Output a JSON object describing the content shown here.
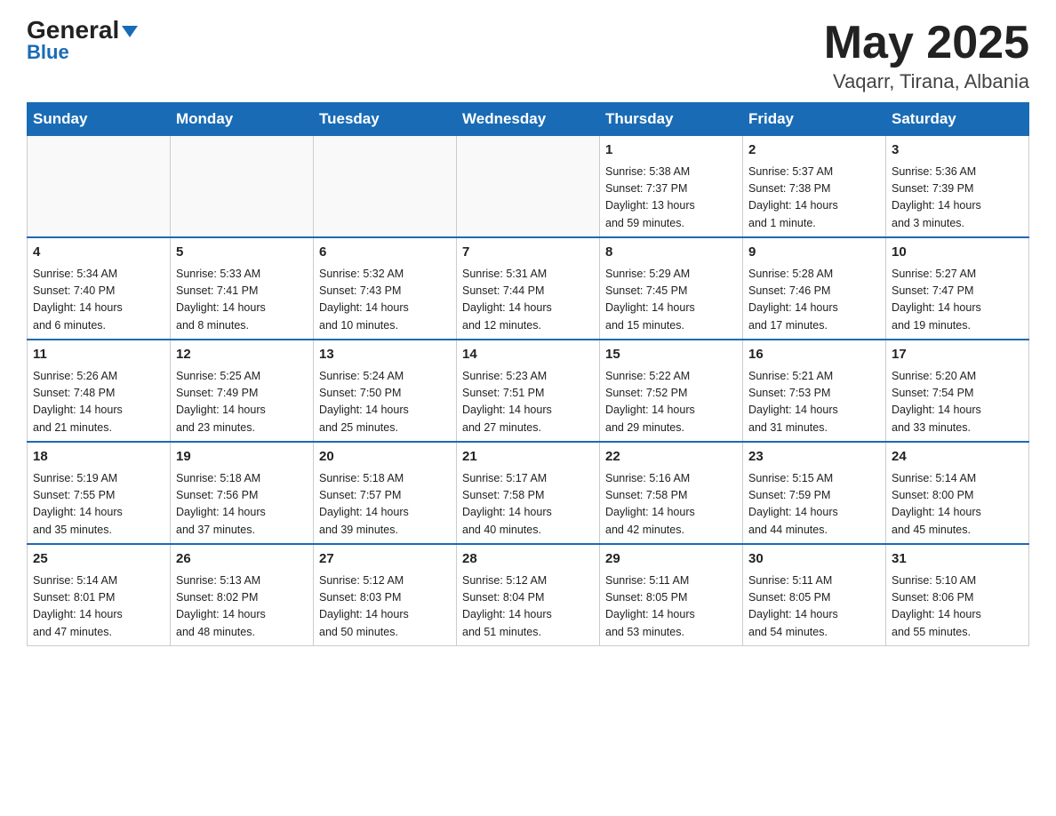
{
  "header": {
    "logo_general": "General",
    "logo_blue": "Blue",
    "month_title": "May 2025",
    "location": "Vaqarr, Tirana, Albania"
  },
  "weekdays": [
    "Sunday",
    "Monday",
    "Tuesday",
    "Wednesday",
    "Thursday",
    "Friday",
    "Saturday"
  ],
  "weeks": [
    [
      {
        "day": "",
        "info": ""
      },
      {
        "day": "",
        "info": ""
      },
      {
        "day": "",
        "info": ""
      },
      {
        "day": "",
        "info": ""
      },
      {
        "day": "1",
        "info": "Sunrise: 5:38 AM\nSunset: 7:37 PM\nDaylight: 13 hours\nand 59 minutes."
      },
      {
        "day": "2",
        "info": "Sunrise: 5:37 AM\nSunset: 7:38 PM\nDaylight: 14 hours\nand 1 minute."
      },
      {
        "day": "3",
        "info": "Sunrise: 5:36 AM\nSunset: 7:39 PM\nDaylight: 14 hours\nand 3 minutes."
      }
    ],
    [
      {
        "day": "4",
        "info": "Sunrise: 5:34 AM\nSunset: 7:40 PM\nDaylight: 14 hours\nand 6 minutes."
      },
      {
        "day": "5",
        "info": "Sunrise: 5:33 AM\nSunset: 7:41 PM\nDaylight: 14 hours\nand 8 minutes."
      },
      {
        "day": "6",
        "info": "Sunrise: 5:32 AM\nSunset: 7:43 PM\nDaylight: 14 hours\nand 10 minutes."
      },
      {
        "day": "7",
        "info": "Sunrise: 5:31 AM\nSunset: 7:44 PM\nDaylight: 14 hours\nand 12 minutes."
      },
      {
        "day": "8",
        "info": "Sunrise: 5:29 AM\nSunset: 7:45 PM\nDaylight: 14 hours\nand 15 minutes."
      },
      {
        "day": "9",
        "info": "Sunrise: 5:28 AM\nSunset: 7:46 PM\nDaylight: 14 hours\nand 17 minutes."
      },
      {
        "day": "10",
        "info": "Sunrise: 5:27 AM\nSunset: 7:47 PM\nDaylight: 14 hours\nand 19 minutes."
      }
    ],
    [
      {
        "day": "11",
        "info": "Sunrise: 5:26 AM\nSunset: 7:48 PM\nDaylight: 14 hours\nand 21 minutes."
      },
      {
        "day": "12",
        "info": "Sunrise: 5:25 AM\nSunset: 7:49 PM\nDaylight: 14 hours\nand 23 minutes."
      },
      {
        "day": "13",
        "info": "Sunrise: 5:24 AM\nSunset: 7:50 PM\nDaylight: 14 hours\nand 25 minutes."
      },
      {
        "day": "14",
        "info": "Sunrise: 5:23 AM\nSunset: 7:51 PM\nDaylight: 14 hours\nand 27 minutes."
      },
      {
        "day": "15",
        "info": "Sunrise: 5:22 AM\nSunset: 7:52 PM\nDaylight: 14 hours\nand 29 minutes."
      },
      {
        "day": "16",
        "info": "Sunrise: 5:21 AM\nSunset: 7:53 PM\nDaylight: 14 hours\nand 31 minutes."
      },
      {
        "day": "17",
        "info": "Sunrise: 5:20 AM\nSunset: 7:54 PM\nDaylight: 14 hours\nand 33 minutes."
      }
    ],
    [
      {
        "day": "18",
        "info": "Sunrise: 5:19 AM\nSunset: 7:55 PM\nDaylight: 14 hours\nand 35 minutes."
      },
      {
        "day": "19",
        "info": "Sunrise: 5:18 AM\nSunset: 7:56 PM\nDaylight: 14 hours\nand 37 minutes."
      },
      {
        "day": "20",
        "info": "Sunrise: 5:18 AM\nSunset: 7:57 PM\nDaylight: 14 hours\nand 39 minutes."
      },
      {
        "day": "21",
        "info": "Sunrise: 5:17 AM\nSunset: 7:58 PM\nDaylight: 14 hours\nand 40 minutes."
      },
      {
        "day": "22",
        "info": "Sunrise: 5:16 AM\nSunset: 7:58 PM\nDaylight: 14 hours\nand 42 minutes."
      },
      {
        "day": "23",
        "info": "Sunrise: 5:15 AM\nSunset: 7:59 PM\nDaylight: 14 hours\nand 44 minutes."
      },
      {
        "day": "24",
        "info": "Sunrise: 5:14 AM\nSunset: 8:00 PM\nDaylight: 14 hours\nand 45 minutes."
      }
    ],
    [
      {
        "day": "25",
        "info": "Sunrise: 5:14 AM\nSunset: 8:01 PM\nDaylight: 14 hours\nand 47 minutes."
      },
      {
        "day": "26",
        "info": "Sunrise: 5:13 AM\nSunset: 8:02 PM\nDaylight: 14 hours\nand 48 minutes."
      },
      {
        "day": "27",
        "info": "Sunrise: 5:12 AM\nSunset: 8:03 PM\nDaylight: 14 hours\nand 50 minutes."
      },
      {
        "day": "28",
        "info": "Sunrise: 5:12 AM\nSunset: 8:04 PM\nDaylight: 14 hours\nand 51 minutes."
      },
      {
        "day": "29",
        "info": "Sunrise: 5:11 AM\nSunset: 8:05 PM\nDaylight: 14 hours\nand 53 minutes."
      },
      {
        "day": "30",
        "info": "Sunrise: 5:11 AM\nSunset: 8:05 PM\nDaylight: 14 hours\nand 54 minutes."
      },
      {
        "day": "31",
        "info": "Sunrise: 5:10 AM\nSunset: 8:06 PM\nDaylight: 14 hours\nand 55 minutes."
      }
    ]
  ]
}
